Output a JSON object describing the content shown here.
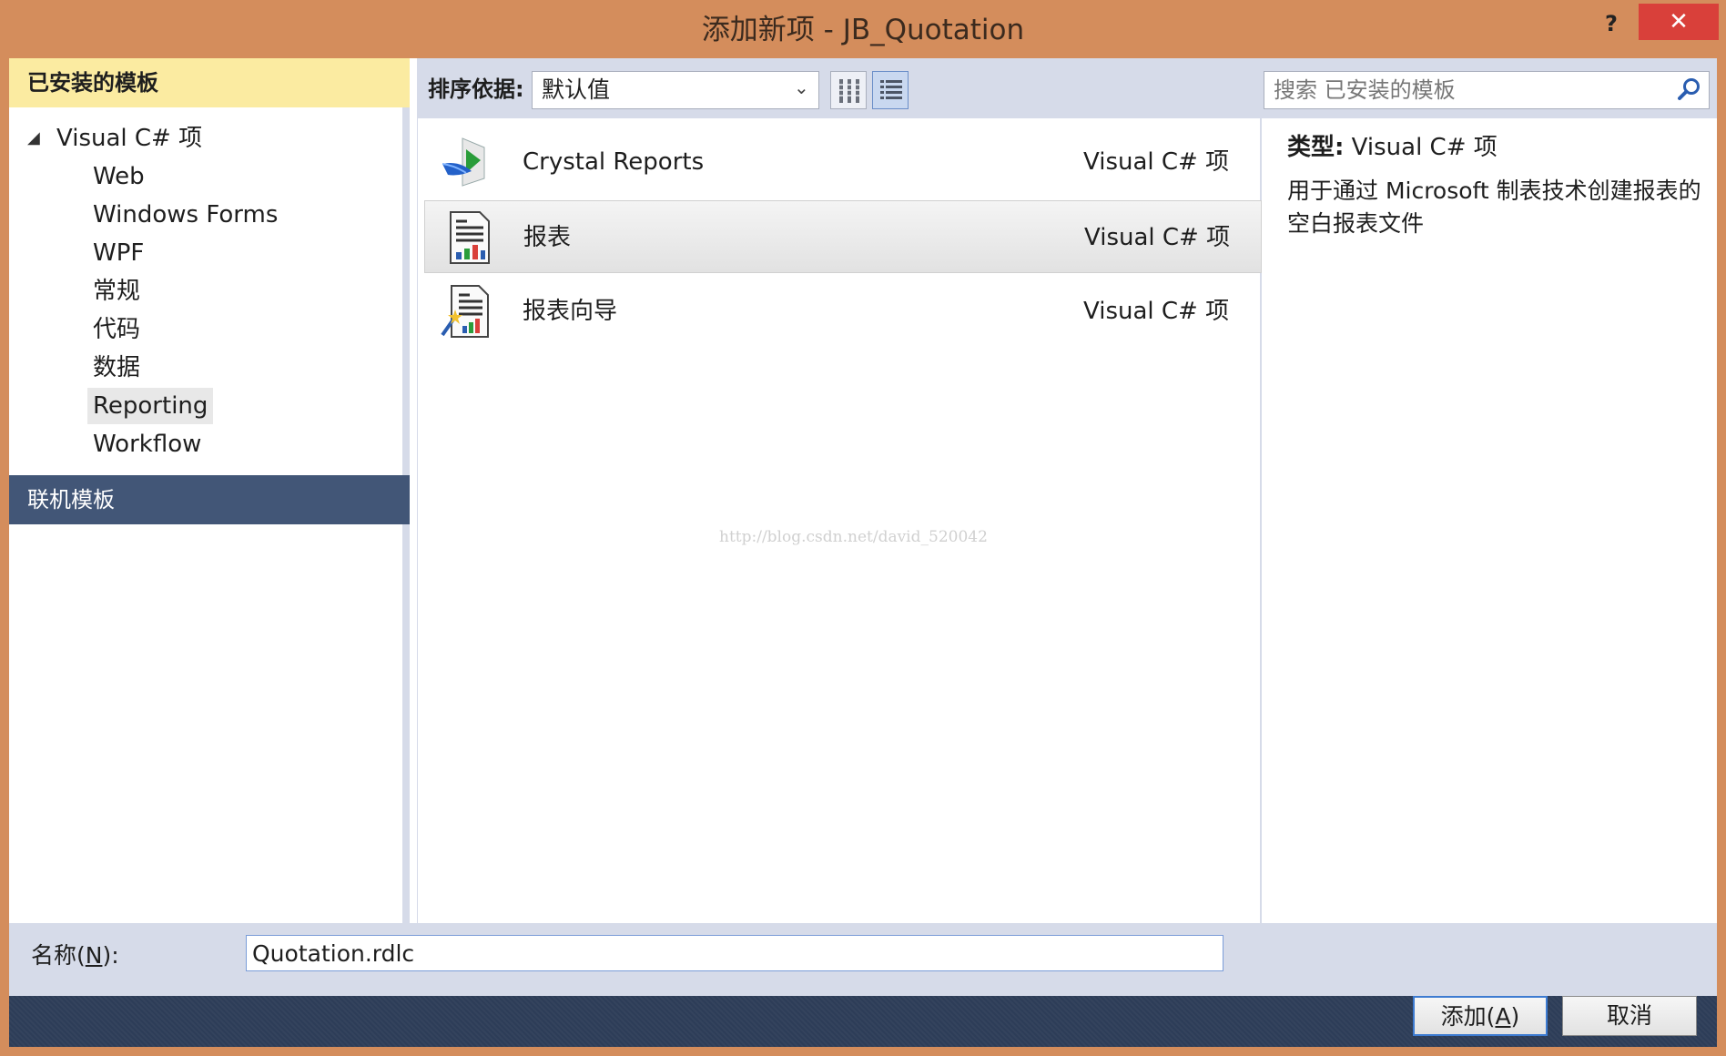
{
  "window": {
    "title": "添加新项 - JB_Quotation",
    "help_label": "?",
    "close_label": "✕"
  },
  "sidebar": {
    "installed_header": "已安装的模板",
    "tree_root_arrow": "◢",
    "tree_root": "Visual C# 项",
    "items": [
      {
        "label": "Web"
      },
      {
        "label": "Windows Forms"
      },
      {
        "label": "WPF"
      },
      {
        "label": "常规"
      },
      {
        "label": "代码"
      },
      {
        "label": "数据"
      },
      {
        "label": "Reporting",
        "selected": true
      },
      {
        "label": "Workflow"
      }
    ],
    "online_header": "联机模板"
  },
  "toolbar": {
    "sort_label": "排序依据:",
    "sort_value": "默认值"
  },
  "search": {
    "placeholder": "搜索 已安装的模板"
  },
  "templates": [
    {
      "name": "Crystal Reports",
      "type": "Visual C# 项",
      "icon": "crystal-reports-icon"
    },
    {
      "name": "报表",
      "type": "Visual C# 项",
      "icon": "report-icon",
      "selected": true
    },
    {
      "name": "报表向导",
      "type": "Visual C# 项",
      "icon": "report-wizard-icon"
    }
  ],
  "details": {
    "type_label": "类型:",
    "type_value": "Visual C# 项",
    "description": "用于通过 Microsoft 制表技术创建报表的空白报表文件"
  },
  "watermark": "http://blog.csdn.net/david_520042",
  "name_field": {
    "label_prefix": "名称(",
    "label_key": "N",
    "label_suffix": "):",
    "value": "Quotation.rdlc"
  },
  "buttons": {
    "add_prefix": "添加(",
    "add_key": "A",
    "add_suffix": ")",
    "cancel": "取消"
  },
  "colors": {
    "frame": "#d48d5c",
    "close": "#d9403a",
    "header_installed": "#fbeba1",
    "header_online": "#425677",
    "footer": "#2d3d58"
  }
}
